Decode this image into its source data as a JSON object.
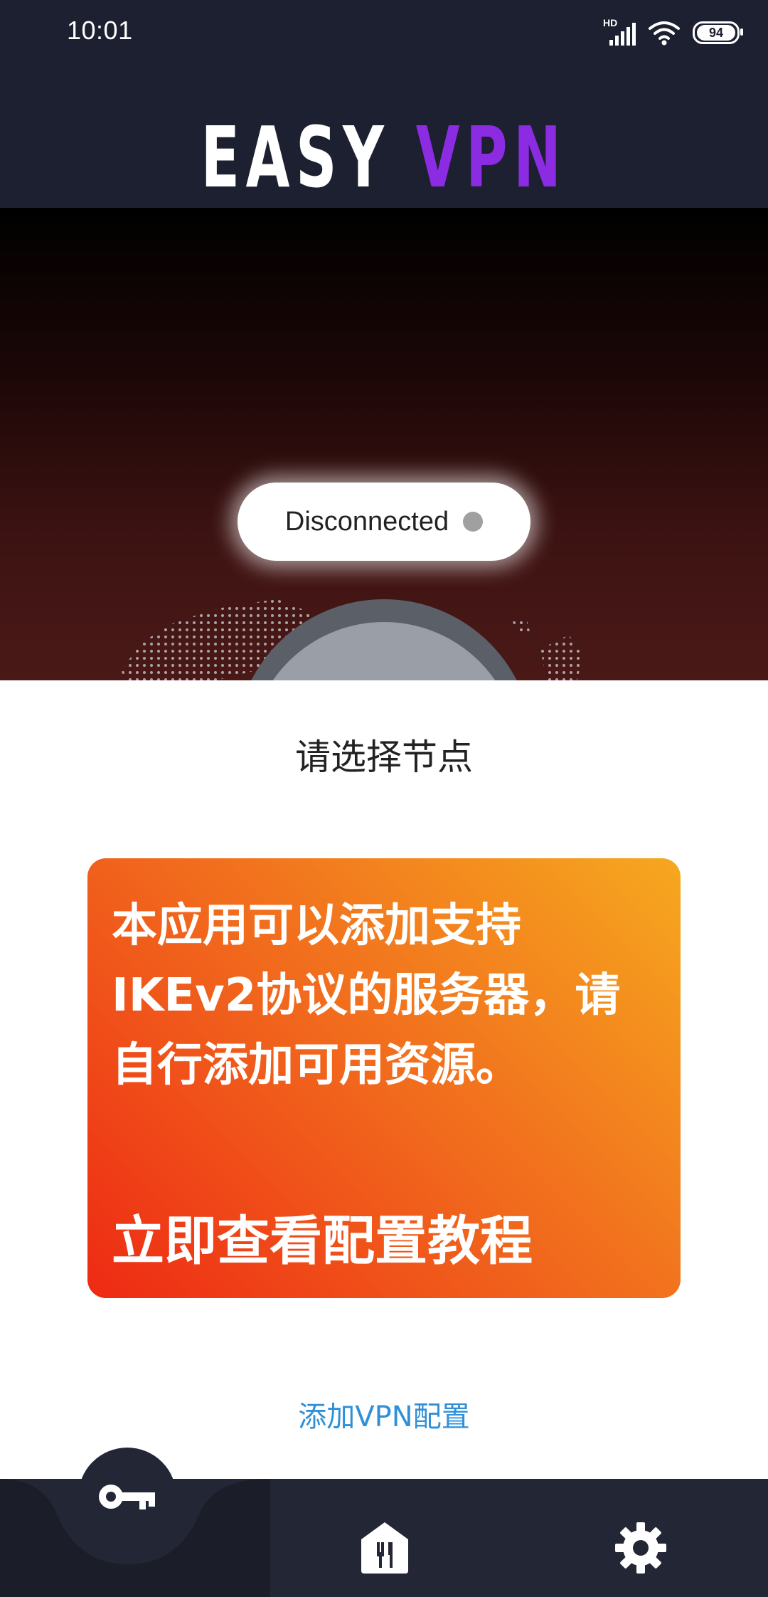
{
  "status_bar": {
    "time": "10:01",
    "battery": "94",
    "signal_label": "HD"
  },
  "header": {
    "logo_part1": "EASY",
    "logo_part2": "VPN",
    "logo_accent_color": "#8b2be2"
  },
  "connection": {
    "status": "Disconnected",
    "status_dot_color": "#a0a0a0"
  },
  "main": {
    "select_node": "请选择节点",
    "promo_lines": [
      "本应用可以添加支持",
      "IKEv2协议的服务器，请",
      "自行添加可用资源。"
    ],
    "promo_cta": "立即查看配置教程",
    "add_config_link": "添加VPN配置"
  },
  "nav": {
    "items": [
      {
        "icon": "key-icon",
        "active": true
      },
      {
        "icon": "restaurant-icon",
        "active": false
      },
      {
        "icon": "gear-icon",
        "active": false
      }
    ]
  }
}
